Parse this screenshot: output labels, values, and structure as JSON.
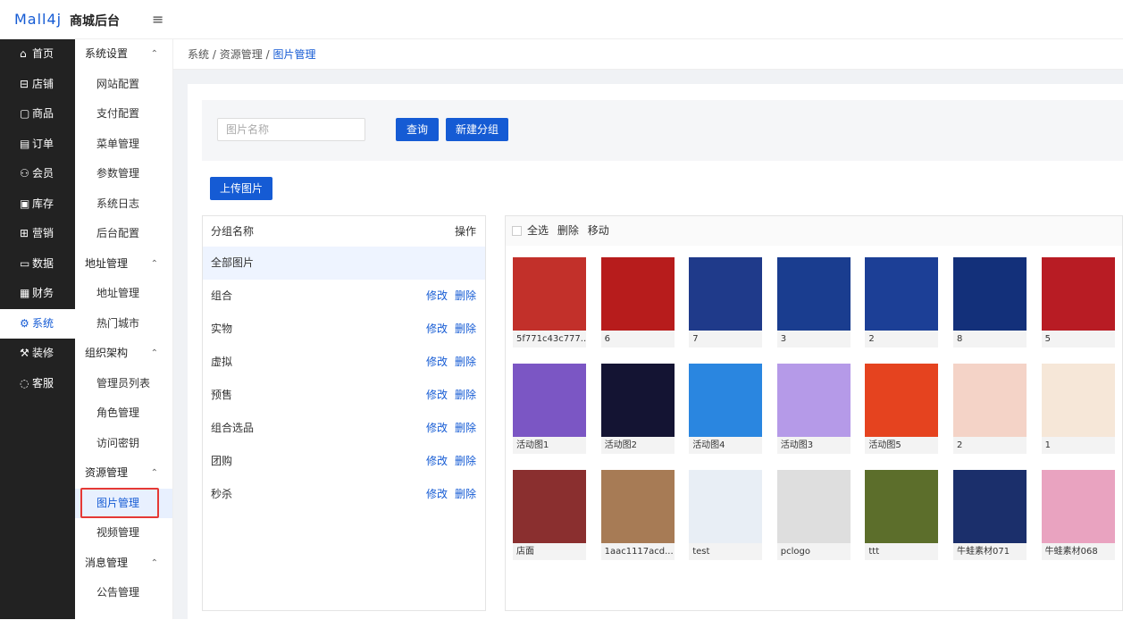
{
  "header": {
    "logo": "Mall4j",
    "brand": "商城后台",
    "fold_icon": "≡"
  },
  "sidebar": [
    {
      "label": "首页",
      "icon": "⌂"
    },
    {
      "label": "店铺",
      "icon": "⊟"
    },
    {
      "label": "商品",
      "icon": "▢"
    },
    {
      "label": "订单",
      "icon": "▤"
    },
    {
      "label": "会员",
      "icon": "⚇"
    },
    {
      "label": "库存",
      "icon": "▣"
    },
    {
      "label": "营销",
      "icon": "⊞"
    },
    {
      "label": "数据",
      "icon": "▭"
    },
    {
      "label": "财务",
      "icon": "▦"
    },
    {
      "label": "系统",
      "icon": "⚙",
      "active": true
    },
    {
      "label": "装修",
      "icon": "⚒"
    },
    {
      "label": "客服",
      "icon": "◌"
    }
  ],
  "submenu": [
    {
      "type": "g",
      "label": "系统设置"
    },
    {
      "type": "i",
      "label": "网站配置"
    },
    {
      "type": "i",
      "label": "支付配置"
    },
    {
      "type": "i",
      "label": "菜单管理"
    },
    {
      "type": "i",
      "label": "参数管理"
    },
    {
      "type": "i",
      "label": "系统日志"
    },
    {
      "type": "i",
      "label": "后台配置"
    },
    {
      "type": "g",
      "label": "地址管理"
    },
    {
      "type": "i",
      "label": "地址管理"
    },
    {
      "type": "i",
      "label": "热门城市"
    },
    {
      "type": "g",
      "label": "组织架构"
    },
    {
      "type": "i",
      "label": "管理员列表"
    },
    {
      "type": "i",
      "label": "角色管理"
    },
    {
      "type": "i",
      "label": "访问密钥"
    },
    {
      "type": "g",
      "label": "资源管理"
    },
    {
      "type": "i",
      "label": "图片管理",
      "active": true
    },
    {
      "type": "i",
      "label": "视频管理"
    },
    {
      "type": "g",
      "label": "消息管理"
    },
    {
      "type": "i",
      "label": "公告管理"
    }
  ],
  "breadcrumb": {
    "a": "系统",
    "sep": "/",
    "b": "资源管理",
    "c": "图片管理"
  },
  "search": {
    "placeholder": "图片名称",
    "query": "查询",
    "new_group": "新建分组",
    "upload": "上传图片"
  },
  "groups": {
    "header": "分组名称",
    "op": "操作",
    "all": "全部图片",
    "edit": "修改",
    "del": "删除",
    "items": [
      "组合",
      "实物",
      "虚拟",
      "预售",
      "组合选品",
      "团购",
      "秒杀"
    ]
  },
  "images": {
    "toolbar": {
      "all": "全选",
      "del": "删除",
      "move": "移动"
    },
    "items": [
      {
        "name": "5f771c43c777...",
        "color": "#c2302a"
      },
      {
        "name": "6",
        "color": "#b71c1c"
      },
      {
        "name": "7",
        "color": "#1f3a8a"
      },
      {
        "name": "3",
        "color": "#1a3d8f"
      },
      {
        "name": "2",
        "color": "#1c3f96"
      },
      {
        "name": "8",
        "color": "#13307a"
      },
      {
        "name": "5",
        "color": "#b81c24"
      },
      {
        "name": "活动图1",
        "color": "#7b56c4"
      },
      {
        "name": "活动图2",
        "color": "#141433"
      },
      {
        "name": "活动图4",
        "color": "#2a86e0"
      },
      {
        "name": "活动图3",
        "color": "#b59ae8"
      },
      {
        "name": "活动图5",
        "color": "#e5431f"
      },
      {
        "name": "2",
        "color": "#f4d3c7"
      },
      {
        "name": "1",
        "color": "#f6e7d8"
      },
      {
        "name": "店面",
        "color": "#8a2f2f"
      },
      {
        "name": "1aac1117acd...",
        "color": "#a77b55"
      },
      {
        "name": "test",
        "color": "#e8eef5"
      },
      {
        "name": "pclogo",
        "color": "#dedede"
      },
      {
        "name": "ttt",
        "color": "#5c6e2b"
      },
      {
        "name": "牛蛙素材071",
        "color": "#1b2f6b"
      },
      {
        "name": "牛蛙素材068",
        "color": "#e9a3c0"
      }
    ]
  }
}
